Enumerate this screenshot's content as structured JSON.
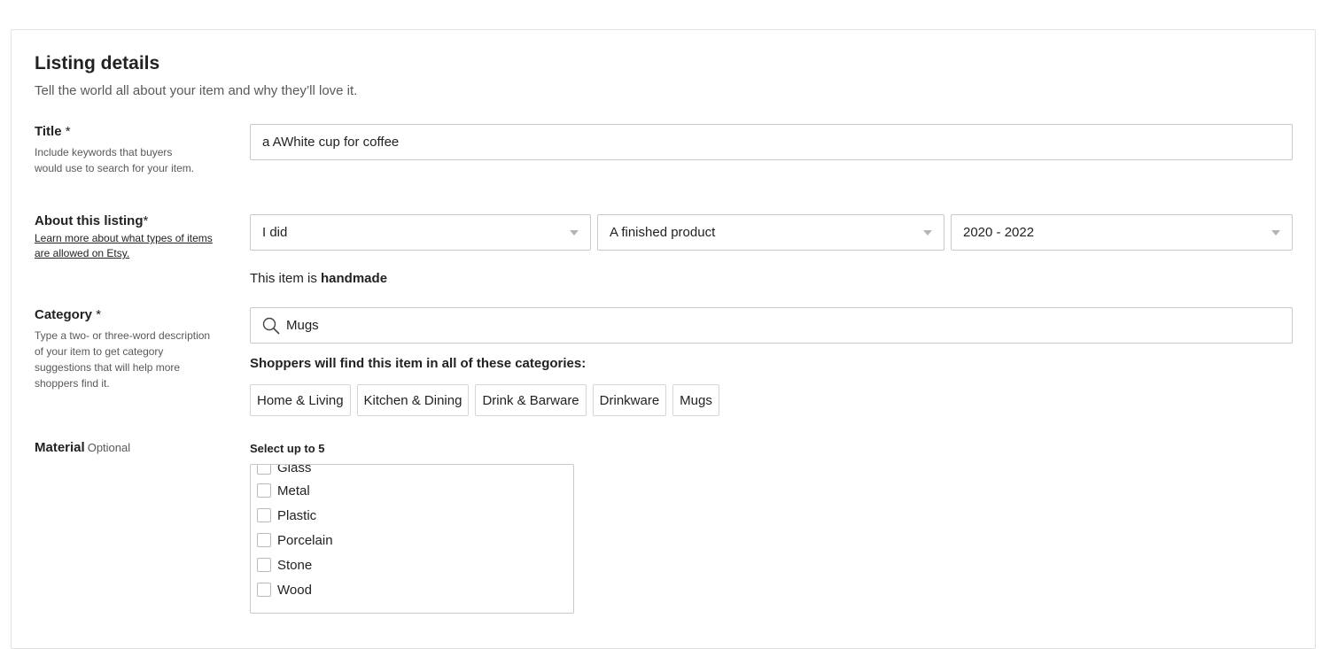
{
  "section": {
    "title": "Listing details",
    "subtitle": "Tell the world all about your item and why they’ll love it."
  },
  "title_field": {
    "label": "Title",
    "required_mark": "*",
    "help": "Include keywords that buyers would use to search for your item.",
    "value": "a AWhite cup for coffee"
  },
  "about_field": {
    "label": "About this listing",
    "required_mark": "*",
    "help_link": "Learn more about what types of items are allowed on Etsy.",
    "who_made": "I did",
    "what_is_it": "A finished product",
    "when_made": "2020 - 2022",
    "handmade_prefix": "This item is ",
    "handmade_word": "handmade"
  },
  "category_field": {
    "label": "Category",
    "required_mark": "*",
    "help": "Type a two- or three-word description of your item to get category suggestions that will help more shoppers find it.",
    "value": "Mugs",
    "shoppers_note": "Shoppers will find this item in all of these categories:",
    "breadcrumbs": [
      "Home & Living",
      "Kitchen & Dining",
      "Drink & Barware",
      "Drinkware",
      "Mugs"
    ]
  },
  "material_field": {
    "label": "Material",
    "optional_label": "Optional",
    "select_limit": "Select up to 5",
    "options": [
      {
        "label": "Glass",
        "checked": false
      },
      {
        "label": "Metal",
        "checked": false
      },
      {
        "label": "Plastic",
        "checked": false
      },
      {
        "label": "Porcelain",
        "checked": false
      },
      {
        "label": "Stone",
        "checked": false
      },
      {
        "label": "Wood",
        "checked": false
      }
    ]
  },
  "colors": {
    "border": "#c9c9c9",
    "text": "#222222",
    "muted": "#595959"
  },
  "icons": {
    "search": "search-icon",
    "dropdown": "chevron-down-icon"
  }
}
